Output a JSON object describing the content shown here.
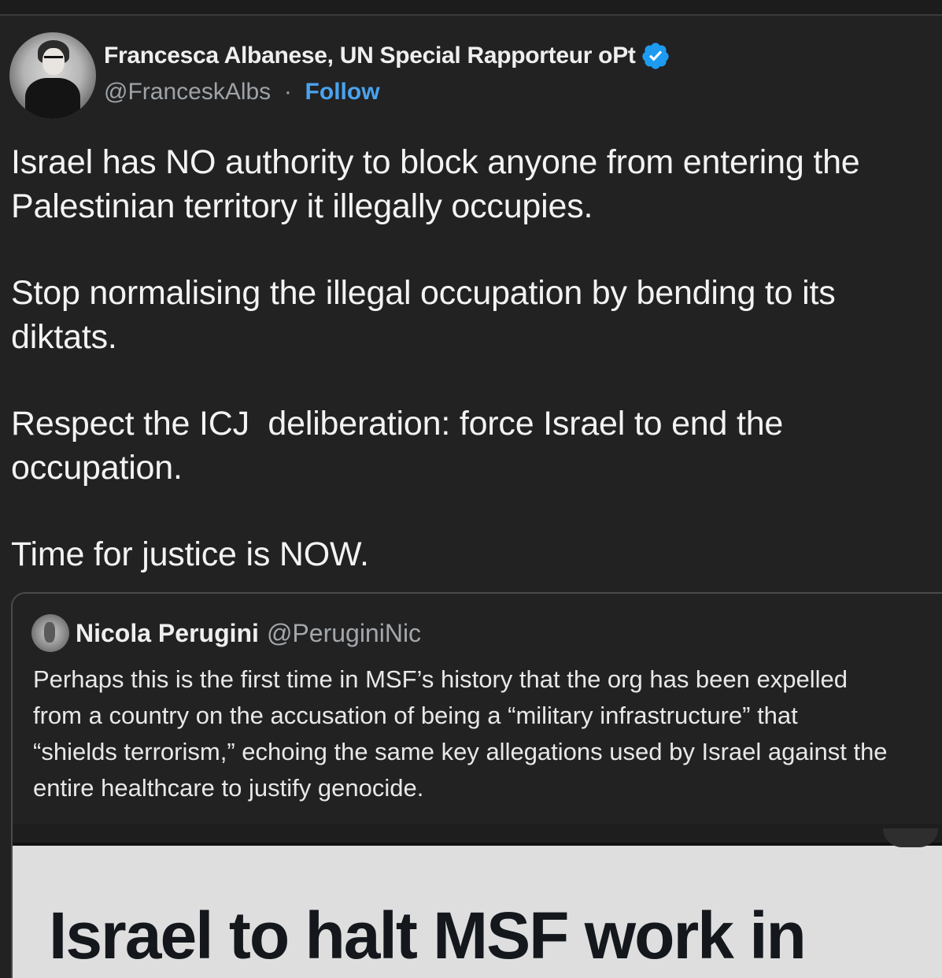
{
  "author": {
    "display_name": "Francesca Albanese, UN Special Rapporteur oPt",
    "handle": "@FranceskAlbs",
    "separator": "·",
    "follow_label": "Follow",
    "verified_icon": "verified-badge-icon",
    "avatar_icon": "profile-photo"
  },
  "tweet": {
    "paragraphs": [
      "Israel has NO authority to block anyone from entering the\nPalestinian territory it illegally occupies.",
      "Stop normalising the illegal occupation by bending to its\ndiktats.",
      "Respect the ICJ  deliberation: force Israel to end the\noccupation.",
      "Time for justice is NOW."
    ]
  },
  "quoted_tweet": {
    "display_name": "Nicola Perugini",
    "handle": "@PeruginiNic",
    "lines": [
      "Perhaps this is the first time in MSF’s history that the org has been expelled",
      "from a country on the accusation of being a “military infrastructure” that",
      "“shields terrorism,” echoing the same key allegations used by Israel against the",
      "entire healthcare to justify genocide."
    ],
    "media_headline": "Israel to halt MSF work in"
  },
  "colors": {
    "background": "#222222",
    "link_blue": "#4aa3ee",
    "verified_blue": "#1d9bf0",
    "muted_text": "#9ea3a8"
  }
}
